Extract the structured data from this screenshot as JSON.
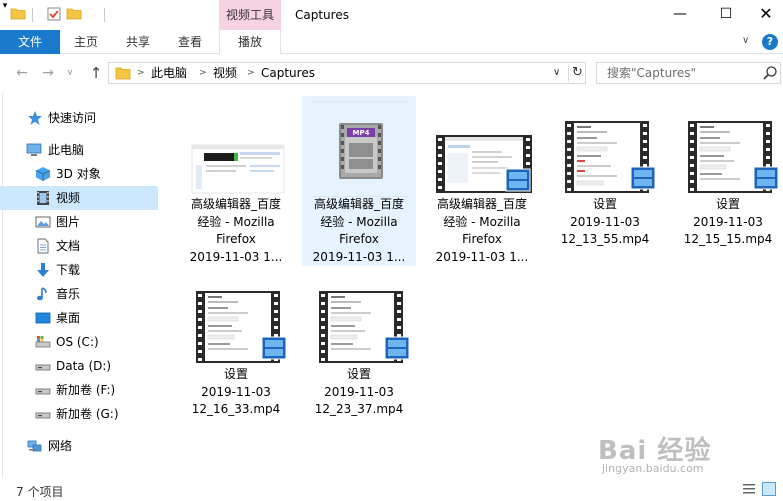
{
  "window": {
    "title": "Captures",
    "context_group": "视频工具",
    "min_glyph": "—",
    "max_glyph": "☐",
    "close_glyph": "✕"
  },
  "quick_access_toolbar": {
    "dropdown_glyph": "▾"
  },
  "ribbon": {
    "tabs": {
      "file": "文件",
      "home": "主页",
      "share": "共享",
      "view": "查看",
      "play": "播放"
    },
    "expand_glyph": "∨",
    "help_glyph": "?"
  },
  "navigation": {
    "back_glyph": "←",
    "forward_glyph": "→",
    "recent_glyph": "∨",
    "up_glyph": "↑"
  },
  "address": {
    "separator": ">",
    "breadcrumbs": [
      "此电脑",
      "视频",
      "Captures"
    ],
    "dropdown_glyph": "∨",
    "refresh_glyph": "↻"
  },
  "search": {
    "placeholder": "搜索\"Captures\""
  },
  "sidebar": {
    "items": [
      {
        "label": "快速访问",
        "icon": "star-icon"
      },
      {
        "label": "此电脑",
        "icon": "computer-icon"
      },
      {
        "label": "3D 对象",
        "icon": "3d-objects-icon"
      },
      {
        "label": "视频",
        "icon": "video-icon",
        "selected": true
      },
      {
        "label": "图片",
        "icon": "pictures-icon"
      },
      {
        "label": "文档",
        "icon": "documents-icon"
      },
      {
        "label": "下载",
        "icon": "download-icon"
      },
      {
        "label": "音乐",
        "icon": "music-icon"
      },
      {
        "label": "桌面",
        "icon": "desktop-icon"
      },
      {
        "label": "OS (C:)",
        "icon": "os-drive-icon"
      },
      {
        "label": "Data (D:)",
        "icon": "drive-icon"
      },
      {
        "label": "新加卷 (F:)",
        "icon": "drive-icon"
      },
      {
        "label": "新加卷 (G:)",
        "icon": "drive-icon"
      },
      {
        "label": "网络",
        "icon": "network-icon"
      }
    ]
  },
  "files": [
    {
      "name_lines": [
        "高级编辑器_百度",
        "经验 - Mozilla",
        "Firefox",
        "2019-11-03 1..."
      ],
      "thumb": "webpage"
    },
    {
      "name_lines": [
        "高级编辑器_百度",
        "经验 - Mozilla",
        "Firefox",
        "2019-11-03 1..."
      ],
      "thumb": "mp4-generic",
      "badge": "MP4",
      "selected": true
    },
    {
      "name_lines": [
        "高级编辑器_百度",
        "经验 - Mozilla",
        "Firefox",
        "2019-11-03 1..."
      ],
      "thumb": "video-webpage"
    },
    {
      "name_lines": [
        "设置",
        "2019-11-03",
        "12_13_55.mp4"
      ],
      "thumb": "video-settings"
    },
    {
      "name_lines": [
        "设置",
        "2019-11-03",
        "12_15_15.mp4"
      ],
      "thumb": "video-settings"
    },
    {
      "name_lines": [
        "设置",
        "2019-11-03",
        "12_16_33.mp4"
      ],
      "thumb": "video-settings"
    },
    {
      "name_lines": [
        "设置",
        "2019-11-03",
        "12_23_37.mp4"
      ],
      "thumb": "video-settings"
    }
  ],
  "status": {
    "item_count": "7 个项目"
  },
  "watermark": {
    "logo": "Bai 经验",
    "url": "jingyan.baidu.com"
  },
  "colors": {
    "accent": "#1979ca",
    "context_tab": "#f7d2e2",
    "selection": "#cce8ff",
    "folder": "#f5c542"
  }
}
